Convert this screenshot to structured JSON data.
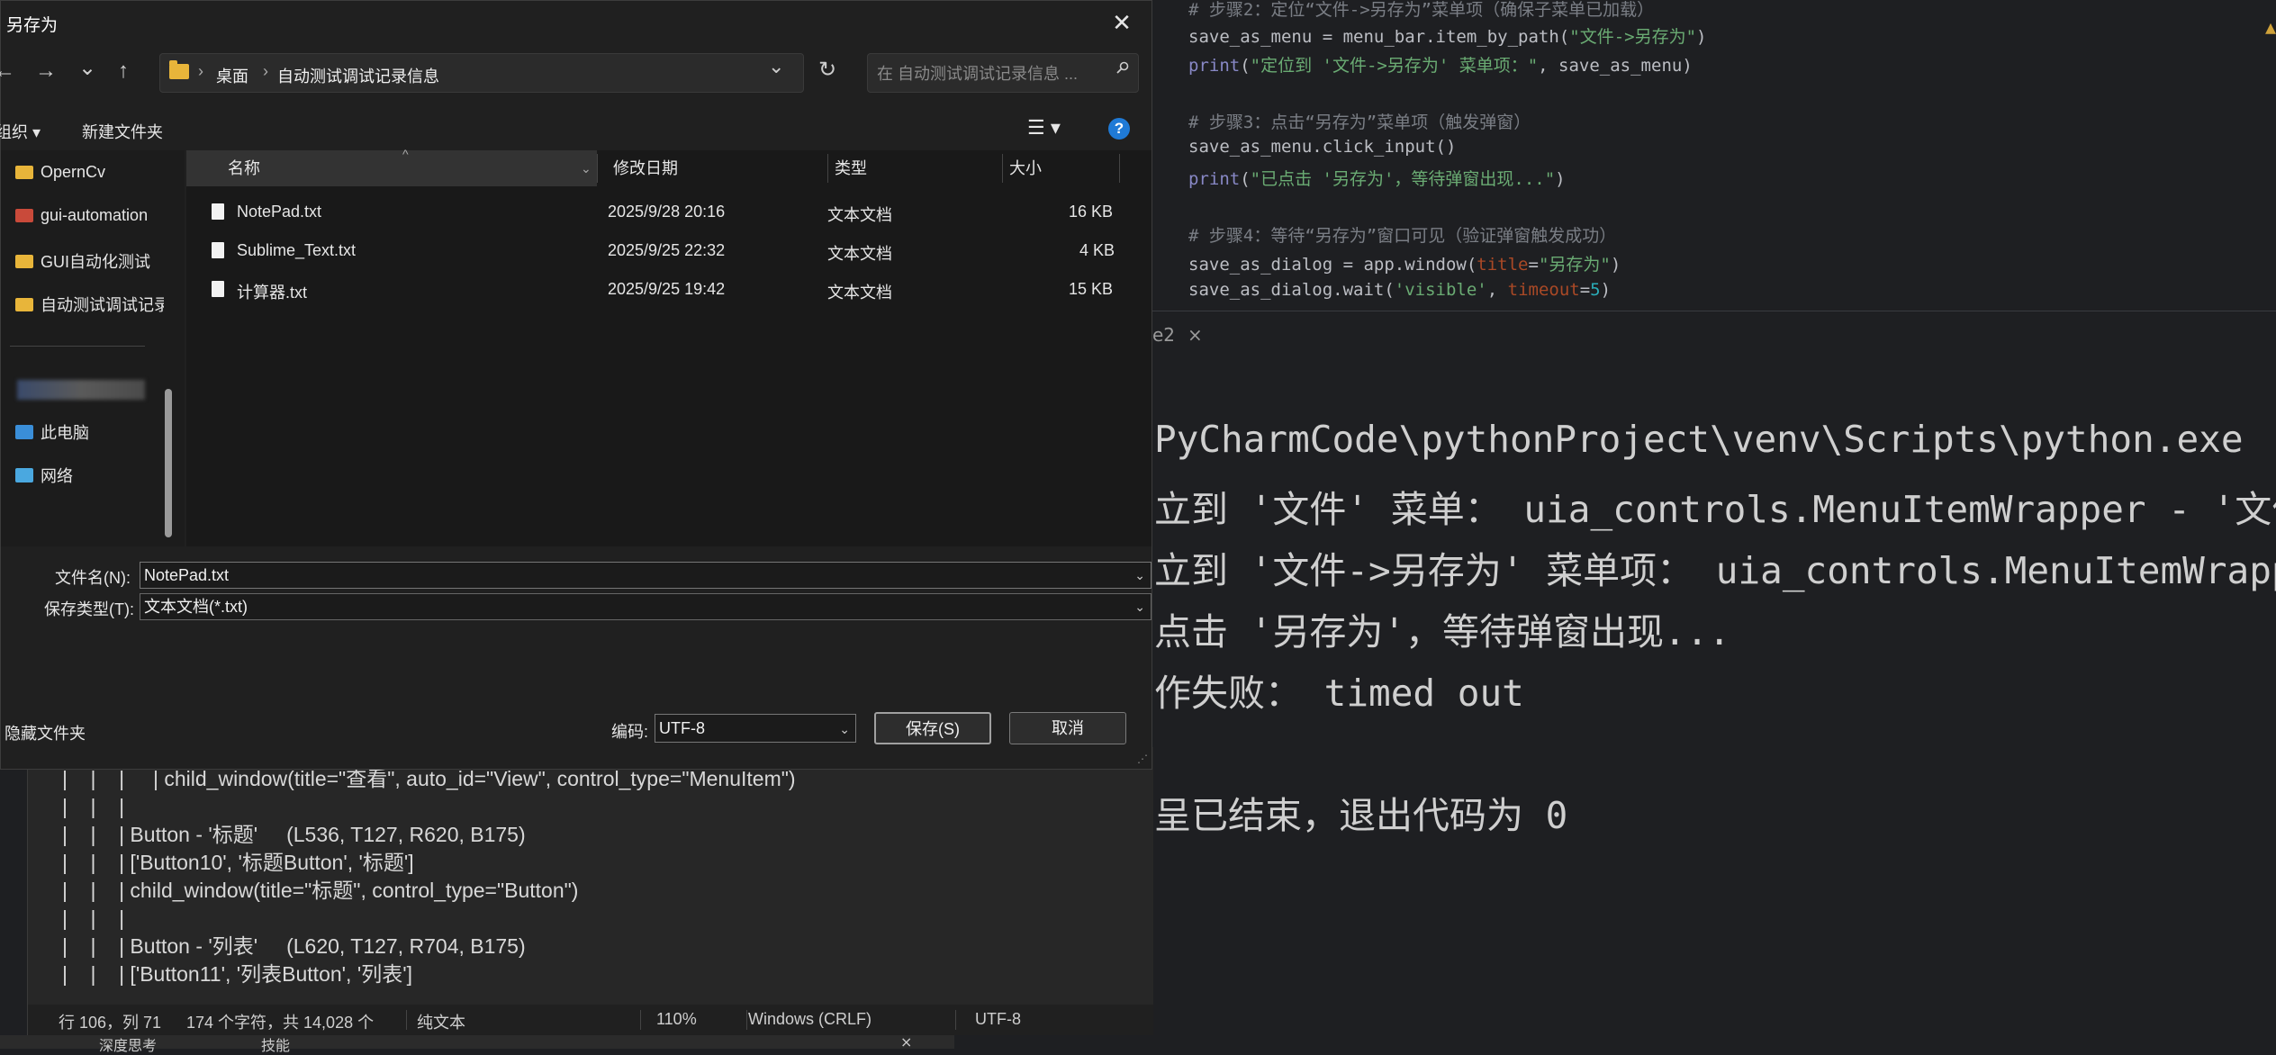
{
  "editor": {
    "line1": {
      "comment": "# 步骤2：定位“文件->另存为”菜单项（确保子菜单已加载）"
    },
    "line2": {
      "code_a": "save_as_menu = menu_bar.item_by_path(",
      "code_str": "\"文件->另存为\"",
      "code_b": ")"
    },
    "line3": {
      "code_fn": "print",
      "code_a": "(",
      "code_str": "\"定位到 '文件->另存为' 菜单项：\"",
      "code_b": ", save_as_menu)"
    },
    "line4": {
      "comment": "# 步骤3：点击“另存为”菜单项（触发弹窗）"
    },
    "line5": {
      "code_a": "save_as_menu.click_input()"
    },
    "line6": {
      "code_fn": "print",
      "code_a": "(",
      "code_str": "\"已点击 '另存为'，等待弹窗出现...\"",
      "code_b": ")"
    },
    "line7": {
      "comment": "# 步骤4：等待“另存为”窗口可见（验证弹窗触发成功）"
    },
    "line8": {
      "code_a": "save_as_dialog = app.window(",
      "code_param": "title",
      "code_eq": "=",
      "code_str": "\"另存为\"",
      "code_b": ")"
    },
    "line9": {
      "code_a": "save_as_dialog.wait(",
      "code_str": "'visible'",
      "code_c": ", ",
      "code_param": "timeout",
      "code_eq": "=",
      "code_num": "5",
      "code_b": ")"
    }
  },
  "run_tab": {
    "label": "e2",
    "close": "×"
  },
  "console": {
    "lines": [
      "PyCharmCode\\pythonProject\\venv\\Scripts\\python.exe",
      "立到 '文件' 菜单： uia_controls.MenuItemWrapper - '文件",
      "立到 '文件->另存为' 菜单项： uia_controls.MenuItemWrapp",
      "点击 '另存为'，等待弹窗出现...",
      "作失败： timed out",
      "",
      "呈已结束，退出代码为 0"
    ]
  },
  "notepad": {
    "text_lines": [
      "|    |    |     | child_window(title=\"查看\", auto_id=\"View\", control_type=\"MenuItem\")",
      "|    |    |",
      "|    |    | Button - '标题'     (L536, T127, R620, B175)",
      "|    |    | ['Button10', '标题Button', '标题']",
      "|    |    | child_window(title=\"标题\", control_type=\"Button\")",
      "|    |    |",
      "|    |    | Button - '列表'     (L620, T127, R704, B175)",
      "|    |    | ['Button11', '列表Button', '列表']"
    ],
    "status": {
      "position": "行 106，列 71",
      "chars": "174 个字符，共 14,028 个",
      "format": "纯文本",
      "zoom": "110%",
      "line_ending": "Windows (CRLF)",
      "encoding": "UTF-8"
    }
  },
  "taskbar": {
    "item1": "深度思考",
    "item2": "技能",
    "close": "×"
  },
  "dialog": {
    "title": "另存为",
    "close": "✕",
    "nav": {
      "back": "←",
      "forward": "→",
      "recent": "⌄",
      "up": "↑"
    },
    "breadcrumb": {
      "sep": "›",
      "items": [
        "桌面",
        "自动测试调试记录信息"
      ]
    },
    "dropdown_glyph": "⌄",
    "refresh_glyph": "↻",
    "search": {
      "placeholder": "在 自动测试调试记录信息 ..."
    },
    "toolbar": {
      "organize": "组织 ▾",
      "new_folder": "新建文件夹",
      "view_glyph": "☰ ▾",
      "help": "?"
    },
    "nav_pane": {
      "items": [
        {
          "label": "OpernCv",
          "icon": "folder-icon"
        },
        {
          "label": "gui-automation",
          "icon": "folder-icon"
        },
        {
          "label": "GUI自动化测试",
          "icon": "folder-icon"
        },
        {
          "label": "自动测试调试记录",
          "icon": "folder-icon"
        },
        {
          "label": "此电脑",
          "icon": "computer-icon"
        },
        {
          "label": "网络",
          "icon": "network-icon"
        }
      ]
    },
    "columns": {
      "name": "名称",
      "modified": "修改日期",
      "type": "类型",
      "size": "大小"
    },
    "files": [
      {
        "name": "NotePad.txt",
        "modified": "2025/9/28 20:16",
        "type": "文本文档",
        "size": "16 KB"
      },
      {
        "name": "Sublime_Text.txt",
        "modified": "2025/9/25 22:32",
        "type": "文本文档",
        "size": "4 KB"
      },
      {
        "name": "计算器.txt",
        "modified": "2025/9/25 19:42",
        "type": "文本文档",
        "size": "15 KB"
      }
    ],
    "form": {
      "filename_label": "文件名(N):",
      "filename_value": "NotePad.txt",
      "filetype_label": "保存类型(T):",
      "filetype_value": "文本文档(*.txt)",
      "hide_folders": "隐藏文件夹",
      "encoding_label": "编码:",
      "encoding_value": "UTF-8",
      "save": "保存(S)",
      "cancel": "取消"
    }
  }
}
